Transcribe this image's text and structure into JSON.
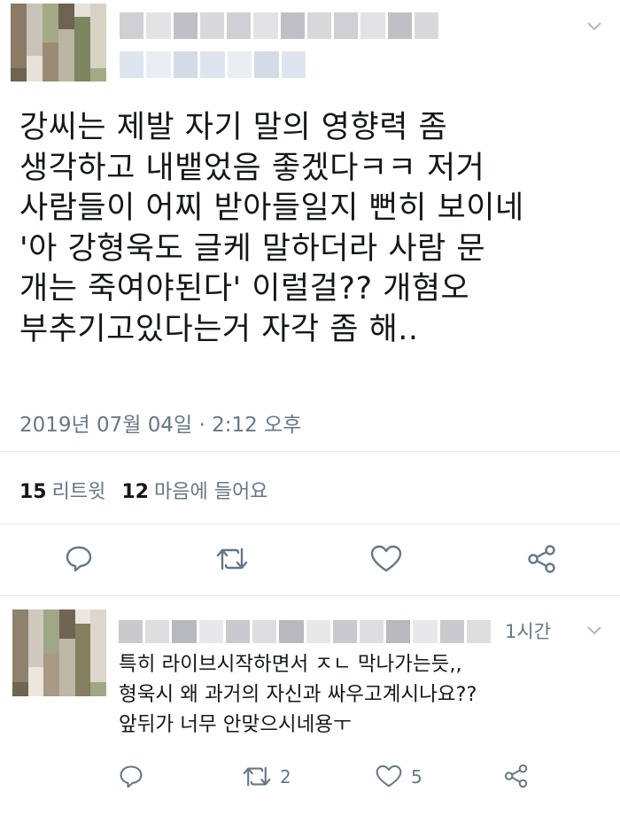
{
  "tweet": {
    "text": "강씨는 제발 자기 말의 영향력 좀\n생각하고 내뱉었음 좋겠다ㅋㅋ 저거\n사람들이 어찌 받아들일지 뻔히 보이네\n'아 강형욱도 글케 말하더라 사람 문\n개는 죽여야된다' 이럴걸?? 개혐오\n부추기고있다는거 자각 좀 해..",
    "timestamp": "2019년 07월 04일 · 2:12 오후",
    "retweet_count": "15",
    "retweet_label": "리트윗",
    "like_count": "12",
    "like_label": "마음에 들어요"
  },
  "reply": {
    "time": "1시간",
    "text": "특히 라이브시작하면서 ㅈㄴ 막나가는듯,,\n형욱시 왜 과거의 자신과 싸우고계시나요??\n앞뒤가 너무 안맞으시네용ㅜ",
    "retweet_count": "2",
    "like_count": "5"
  },
  "icons": {
    "reply": "reply-icon",
    "retweet": "retweet-icon",
    "like": "heart-icon",
    "share": "share-icon",
    "menu": "chevron-down-icon"
  },
  "colors": {
    "text": "#14171a",
    "secondary": "#657786",
    "divider": "#e1e8ed"
  }
}
